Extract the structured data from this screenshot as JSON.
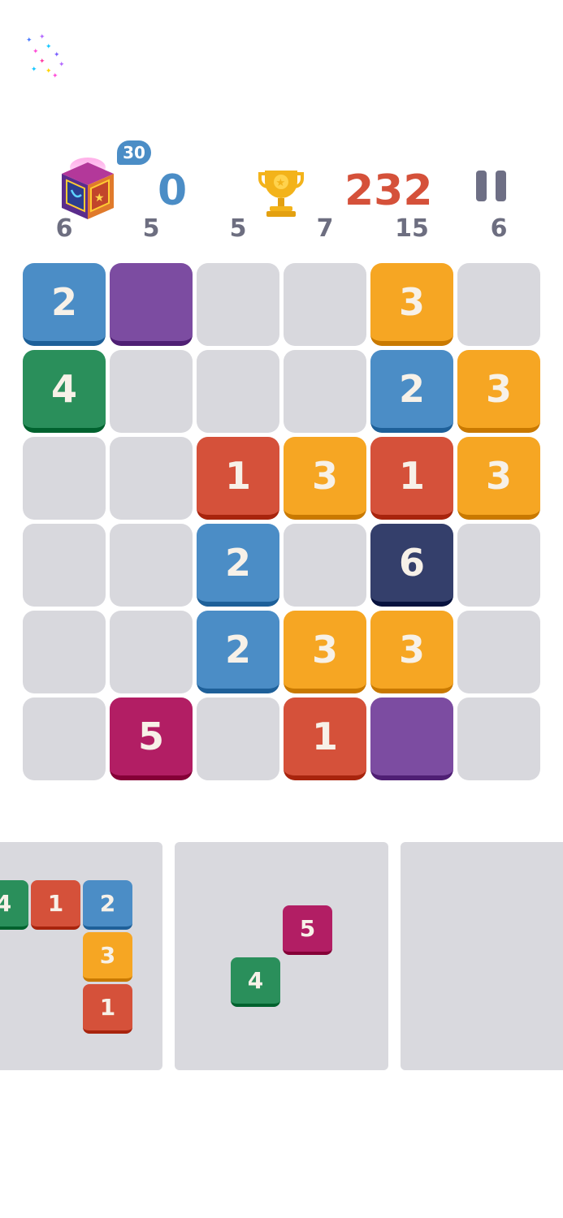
{
  "header": {
    "chest_badge": "30",
    "score": "0",
    "best_score": "232"
  },
  "counts": [
    "6",
    "5",
    "5",
    "7",
    "15",
    "6"
  ],
  "colors": {
    "1": "#d5513a",
    "2": "#4b8dc6",
    "3": "#f6a623",
    "4": "#2a8f5b",
    "5": "#b21e64",
    "6": "#343f6b",
    "purple": "#7c4ca1",
    "empty": "#d8d8dd"
  },
  "board": [
    [
      "2",
      "P",
      "",
      "",
      "3",
      ""
    ],
    [
      "4",
      "",
      "",
      "",
      "2",
      "3"
    ],
    [
      "",
      "",
      "1",
      "3",
      "1",
      "3"
    ],
    [
      "",
      "",
      "2",
      "",
      "6",
      ""
    ],
    [
      "",
      "",
      "2",
      "3",
      "3",
      ""
    ],
    [
      "",
      "5",
      "",
      "1",
      "P",
      ""
    ]
  ],
  "trays": [
    {
      "pieces": [
        "4",
        "1",
        "2",
        "3",
        "1"
      ]
    },
    {
      "pieces": [
        "5",
        "4"
      ]
    },
    {
      "pieces": []
    }
  ]
}
